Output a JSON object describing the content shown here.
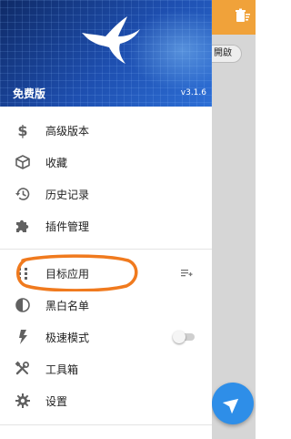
{
  "header": {
    "edition": "免费版",
    "version": "v3.1.6"
  },
  "menu": {
    "premium": "高级版本",
    "favorites": "收藏",
    "history": "历史记录",
    "plugins": "插件管理",
    "target_apps": "目标应用",
    "blacklist": "黑白名单",
    "turbo_mode": "极速模式",
    "toolbox": "工具箱",
    "settings": "设置"
  },
  "turbo_mode_enabled": false,
  "background": {
    "chip_label": "開啟"
  },
  "colors": {
    "header": "#1e4fb0",
    "accent_orange": "#f0a23a",
    "fab": "#2e8ee8",
    "annotation": "#f07a1e"
  }
}
